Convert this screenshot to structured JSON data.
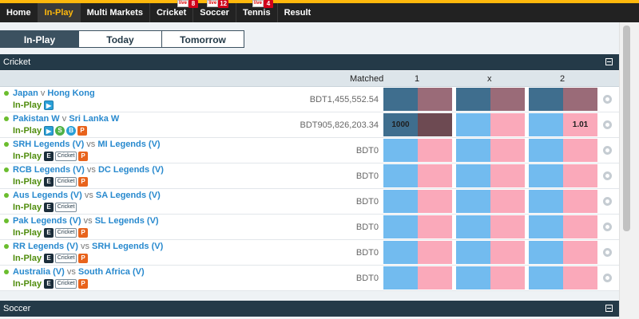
{
  "nav": {
    "items": [
      {
        "label": "Home",
        "active": false
      },
      {
        "label": "In-Play",
        "active": true
      },
      {
        "label": "Multi Markets",
        "active": false
      },
      {
        "label": "Cricket",
        "active": false,
        "badge": "8"
      },
      {
        "label": "Soccer",
        "active": false,
        "badge": "12"
      },
      {
        "label": "Tennis",
        "active": false,
        "badge": "4"
      },
      {
        "label": "Result",
        "active": false
      }
    ],
    "badge_icon_text": "live"
  },
  "tabs": [
    {
      "label": "In-Play",
      "active": true
    },
    {
      "label": "Today",
      "active": false
    },
    {
      "label": "Tomorrow",
      "active": false
    }
  ],
  "sections": {
    "cricket": {
      "title": "Cricket"
    },
    "soccer": {
      "title": "Soccer"
    }
  },
  "columns": {
    "matched": "Matched",
    "col1": "1",
    "colx": "x",
    "col2": "2"
  },
  "status_label": "In-Play",
  "icon_text": {
    "e": "E",
    "cricket": "Cricket",
    "s": "S",
    "b": "B",
    "p": "P",
    "tv": "▶"
  },
  "matches": [
    {
      "team1": "Japan",
      "sep": "v",
      "team2": "Hong Kong",
      "matched": "BDT1,455,552.54",
      "icons": [
        "tv-icon"
      ],
      "odds": [
        "",
        "",
        "",
        "",
        "",
        ""
      ],
      "suspended": true
    },
    {
      "team1": "Pakistan W",
      "sep": "v",
      "team2": "Sri Lanka W",
      "matched": "BDT905,826,203.34",
      "icons": [
        "tv-icon",
        "s-icon",
        "b-icon",
        "p-icon"
      ],
      "odds": [
        "1000",
        "",
        "",
        "",
        "",
        "1.01"
      ],
      "suspended": false
    },
    {
      "team1": "SRH Legends (V)",
      "sep": "vs",
      "team2": "MI Legends (V)",
      "matched": "BDT0",
      "icons": [
        "e-icon",
        "cricket-icon",
        "p-icon"
      ],
      "odds": [
        "",
        "",
        "",
        "",
        "",
        ""
      ],
      "suspended": false
    },
    {
      "team1": "RCB Legends (V)",
      "sep": "vs",
      "team2": "DC Legends (V)",
      "matched": "BDT0",
      "icons": [
        "e-icon",
        "cricket-icon",
        "p-icon"
      ],
      "odds": [
        "",
        "",
        "",
        "",
        "",
        ""
      ],
      "suspended": false
    },
    {
      "team1": "Aus Legends (V)",
      "sep": "vs",
      "team2": "SA Legends (V)",
      "matched": "BDT0",
      "icons": [
        "e-icon",
        "cricket-icon"
      ],
      "odds": [
        "",
        "",
        "",
        "",
        "",
        ""
      ],
      "suspended": false
    },
    {
      "team1": "Pak Legends (V)",
      "sep": "vs",
      "team2": "SL Legends (V)",
      "matched": "BDT0",
      "icons": [
        "e-icon",
        "cricket-icon",
        "p-icon"
      ],
      "odds": [
        "",
        "",
        "",
        "",
        "",
        ""
      ],
      "suspended": false
    },
    {
      "team1": "RR Legends (V)",
      "sep": "vs",
      "team2": "SRH Legends (V)",
      "matched": "BDT0",
      "icons": [
        "e-icon",
        "cricket-icon",
        "p-icon"
      ],
      "odds": [
        "",
        "",
        "",
        "",
        "",
        ""
      ],
      "suspended": false
    },
    {
      "team1": "Australia (V)",
      "sep": "vs",
      "team2": "South Africa (V)",
      "matched": "BDT0",
      "icons": [
        "e-icon",
        "cricket-icon",
        "p-icon"
      ],
      "odds": [
        "",
        "",
        "",
        "",
        "",
        ""
      ],
      "suspended": false
    }
  ],
  "colors": {
    "accent": "#ffb80c",
    "back": "#72bbef",
    "lay": "#faa9ba",
    "back_suspended": "#3f6e8e",
    "lay_suspended": "#9a6b78",
    "lay_dark": "#6d4a52",
    "header": "#243a48",
    "link": "#2789ce",
    "inplay": "#508d0e"
  }
}
